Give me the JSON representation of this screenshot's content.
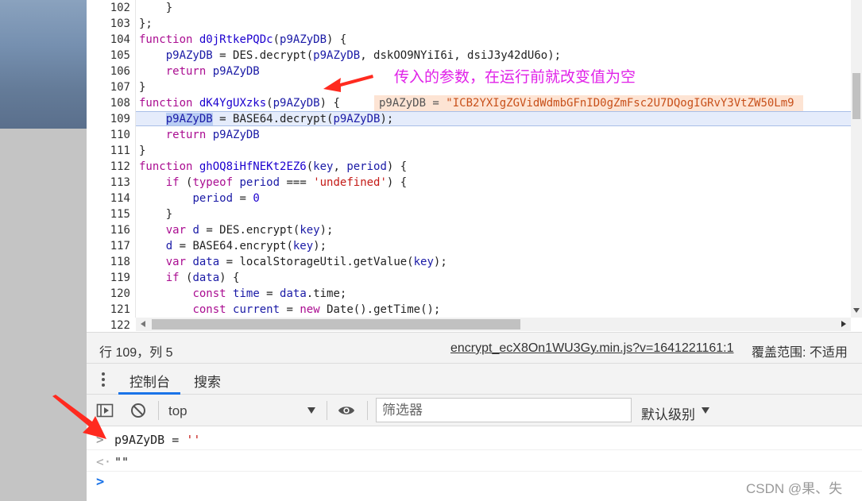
{
  "editor": {
    "lines": [
      {
        "n": "102",
        "indent": "    ",
        "segments": [
          {
            "t": "}",
            "c": ""
          }
        ]
      },
      {
        "n": "103",
        "indent": "",
        "segments": [
          {
            "t": "};",
            "c": ""
          }
        ]
      },
      {
        "n": "104",
        "indent": "",
        "segments": [
          {
            "t": "function",
            "c": "kw"
          },
          {
            "t": " ",
            "c": ""
          },
          {
            "t": "d0jRtkePQDc",
            "c": "def"
          },
          {
            "t": "(",
            "c": ""
          },
          {
            "t": "p9AZyDB",
            "c": "ident"
          },
          {
            "t": ") {",
            "c": ""
          }
        ]
      },
      {
        "n": "105",
        "indent": "    ",
        "segments": [
          {
            "t": "p9AZyDB",
            "c": "ident"
          },
          {
            "t": " = DES.decrypt(",
            "c": ""
          },
          {
            "t": "p9AZyDB",
            "c": "ident"
          },
          {
            "t": ", dskOO9NYiI6i, dsiJ3y42dU6o);",
            "c": ""
          }
        ]
      },
      {
        "n": "106",
        "indent": "    ",
        "segments": [
          {
            "t": "return",
            "c": "kw"
          },
          {
            "t": " ",
            "c": ""
          },
          {
            "t": "p9AZyDB",
            "c": "ident"
          }
        ]
      },
      {
        "n": "107",
        "indent": "",
        "segments": [
          {
            "t": "}",
            "c": ""
          }
        ]
      },
      {
        "n": "108",
        "indent": "",
        "segments": [
          {
            "t": "function",
            "c": "kw"
          },
          {
            "t": " ",
            "c": ""
          },
          {
            "t": "dK4YgUXzks",
            "c": "def"
          },
          {
            "t": "(",
            "c": ""
          },
          {
            "t": "p9AZyDB",
            "c": "ident"
          },
          {
            "t": ") {",
            "c": ""
          }
        ]
      },
      {
        "n": "109",
        "indent": "    ",
        "segments": [
          {
            "t": "p9AZyDB",
            "c": "ident sel"
          },
          {
            "t": " = BASE64.decrypt(",
            "c": ""
          },
          {
            "t": "p9AZyDB",
            "c": "ident"
          },
          {
            "t": ");",
            "c": ""
          }
        ]
      },
      {
        "n": "110",
        "indent": "    ",
        "segments": [
          {
            "t": "return",
            "c": "kw"
          },
          {
            "t": " ",
            "c": ""
          },
          {
            "t": "p9AZyDB",
            "c": "ident"
          }
        ]
      },
      {
        "n": "111",
        "indent": "",
        "segments": [
          {
            "t": "}",
            "c": ""
          }
        ]
      },
      {
        "n": "112",
        "indent": "",
        "segments": [
          {
            "t": "function",
            "c": "kw"
          },
          {
            "t": " ",
            "c": ""
          },
          {
            "t": "ghOQ8iHfNEKt2EZ6",
            "c": "def"
          },
          {
            "t": "(",
            "c": ""
          },
          {
            "t": "key",
            "c": "ident"
          },
          {
            "t": ", ",
            "c": ""
          },
          {
            "t": "period",
            "c": "ident"
          },
          {
            "t": ") {",
            "c": ""
          }
        ]
      },
      {
        "n": "113",
        "indent": "    ",
        "segments": [
          {
            "t": "if",
            "c": "kw"
          },
          {
            "t": " (",
            "c": ""
          },
          {
            "t": "typeof",
            "c": "kw"
          },
          {
            "t": " ",
            "c": ""
          },
          {
            "t": "period",
            "c": "ident"
          },
          {
            "t": " === ",
            "c": ""
          },
          {
            "t": "'undefined'",
            "c": "str"
          },
          {
            "t": ") {",
            "c": ""
          }
        ]
      },
      {
        "n": "114",
        "indent": "        ",
        "segments": [
          {
            "t": "period",
            "c": "ident"
          },
          {
            "t": " = ",
            "c": ""
          },
          {
            "t": "0",
            "c": "num"
          }
        ]
      },
      {
        "n": "115",
        "indent": "    ",
        "segments": [
          {
            "t": "}",
            "c": ""
          }
        ]
      },
      {
        "n": "116",
        "indent": "    ",
        "segments": [
          {
            "t": "var",
            "c": "kw"
          },
          {
            "t": " ",
            "c": ""
          },
          {
            "t": "d",
            "c": "ident"
          },
          {
            "t": " = DES.encrypt(",
            "c": ""
          },
          {
            "t": "key",
            "c": "ident"
          },
          {
            "t": ");",
            "c": ""
          }
        ]
      },
      {
        "n": "117",
        "indent": "    ",
        "segments": [
          {
            "t": "d",
            "c": "ident"
          },
          {
            "t": " = BASE64.encrypt(",
            "c": ""
          },
          {
            "t": "key",
            "c": "ident"
          },
          {
            "t": ");",
            "c": ""
          }
        ]
      },
      {
        "n": "118",
        "indent": "    ",
        "segments": [
          {
            "t": "var",
            "c": "kw"
          },
          {
            "t": " ",
            "c": ""
          },
          {
            "t": "data",
            "c": "ident"
          },
          {
            "t": " = localStorageUtil.getValue(",
            "c": ""
          },
          {
            "t": "key",
            "c": "ident"
          },
          {
            "t": ");",
            "c": ""
          }
        ]
      },
      {
        "n": "119",
        "indent": "    ",
        "segments": [
          {
            "t": "if",
            "c": "kw"
          },
          {
            "t": " (",
            "c": ""
          },
          {
            "t": "data",
            "c": "ident"
          },
          {
            "t": ") {",
            "c": ""
          }
        ]
      },
      {
        "n": "120",
        "indent": "        ",
        "segments": [
          {
            "t": "const",
            "c": "kw"
          },
          {
            "t": " ",
            "c": ""
          },
          {
            "t": "time",
            "c": "ident"
          },
          {
            "t": " = ",
            "c": ""
          },
          {
            "t": "data",
            "c": "ident"
          },
          {
            "t": ".time;",
            "c": ""
          }
        ]
      },
      {
        "n": "121",
        "indent": "        ",
        "segments": [
          {
            "t": "const",
            "c": "kw"
          },
          {
            "t": " ",
            "c": ""
          },
          {
            "t": "current",
            "c": "ident"
          },
          {
            "t": " = ",
            "c": ""
          },
          {
            "t": "new",
            "c": "kw"
          },
          {
            "t": " Date().getTime();",
            "c": ""
          }
        ]
      },
      {
        "n": "122",
        "indent": "",
        "segments": []
      }
    ],
    "inline_value": {
      "name": "p9AZyDB = ",
      "value": "\"ICB2YXIgZGVidWdmbGFnID0gZmFsc2U7DQogIGRvY3VtZW50Lm9"
    },
    "annotation": "传入的参数，在运行前就改变值为空"
  },
  "status_bar": {
    "position": "行 109，列 5",
    "file": "encrypt_ecX8On1WU3Gy.min.js?v=1641221161:1",
    "coverage": "覆盖范围: 不适用"
  },
  "drawer": {
    "tabs": [
      {
        "label": "控制台",
        "active": true
      },
      {
        "label": "搜索",
        "active": false
      }
    ]
  },
  "console_toolbar": {
    "context": "top",
    "filter_placeholder": "筛选器",
    "level": "默认级别"
  },
  "console": {
    "input_line": "p9AZyDB = ''",
    "input_name": "p9AZyDB",
    "input_op": " = ",
    "input_value": "''",
    "output_line": "\"\""
  },
  "watermark": "CSDN @果、失",
  "colors": {
    "annotation": "#e021e8",
    "arrow": "#ff2a1f",
    "active_tab": "#1a73e8"
  }
}
